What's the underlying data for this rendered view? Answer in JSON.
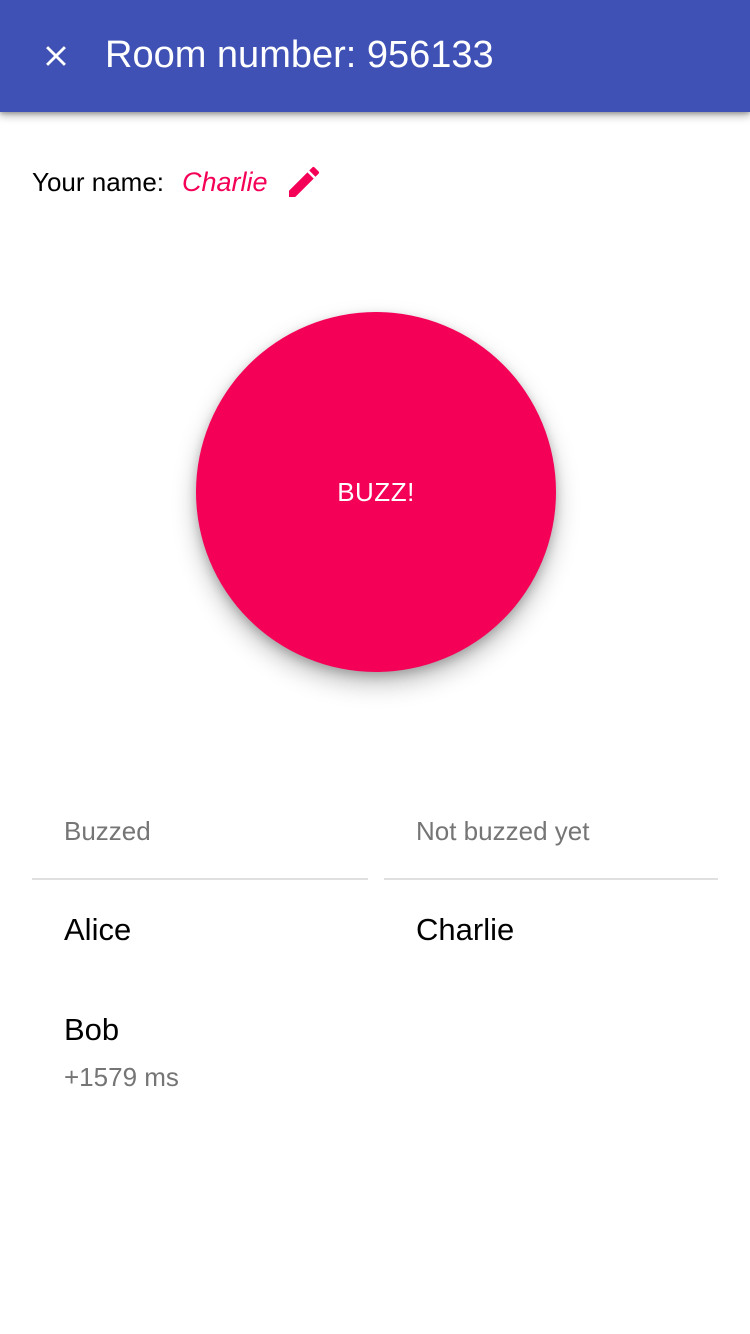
{
  "header": {
    "title": "Room number: 956133",
    "close_icon": "close-icon",
    "background_color": "#3f51b5"
  },
  "profile": {
    "label": "Your name:",
    "name": "Charlie",
    "edit_icon": "pencil-icon",
    "accent_color": "#f50057"
  },
  "buzzer": {
    "label": "BUZZ!",
    "color": "#f50057"
  },
  "buzzed": {
    "header": "Buzzed",
    "players": [
      {
        "name": "Alice",
        "delay": ""
      },
      {
        "name": "Bob",
        "delay": "+1579 ms"
      }
    ]
  },
  "not_buzzed": {
    "header": "Not buzzed yet",
    "players": [
      {
        "name": "Charlie"
      }
    ]
  }
}
